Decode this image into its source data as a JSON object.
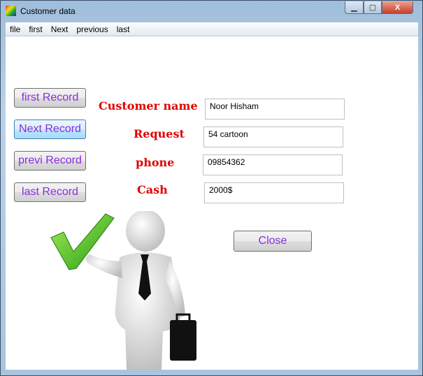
{
  "window": {
    "title": "Customer data",
    "minimize": "▁",
    "maximize": "▢",
    "close": "X"
  },
  "menu": [
    "file",
    "first",
    "Next",
    "previous",
    "last"
  ],
  "nav_buttons": [
    "first Record",
    "Next Record",
    "previ Record",
    "last Record"
  ],
  "fields": [
    {
      "label": "Customer name",
      "value": "Noor Hisham"
    },
    {
      "label": "Request",
      "value": "54 cartoon"
    },
    {
      "label": "phone",
      "value": "09854362"
    },
    {
      "label": "Cash",
      "value": "2000$"
    }
  ],
  "close_label": "Close",
  "colors": {
    "button_text": "#8a2be2",
    "label_text": "#e00000"
  }
}
